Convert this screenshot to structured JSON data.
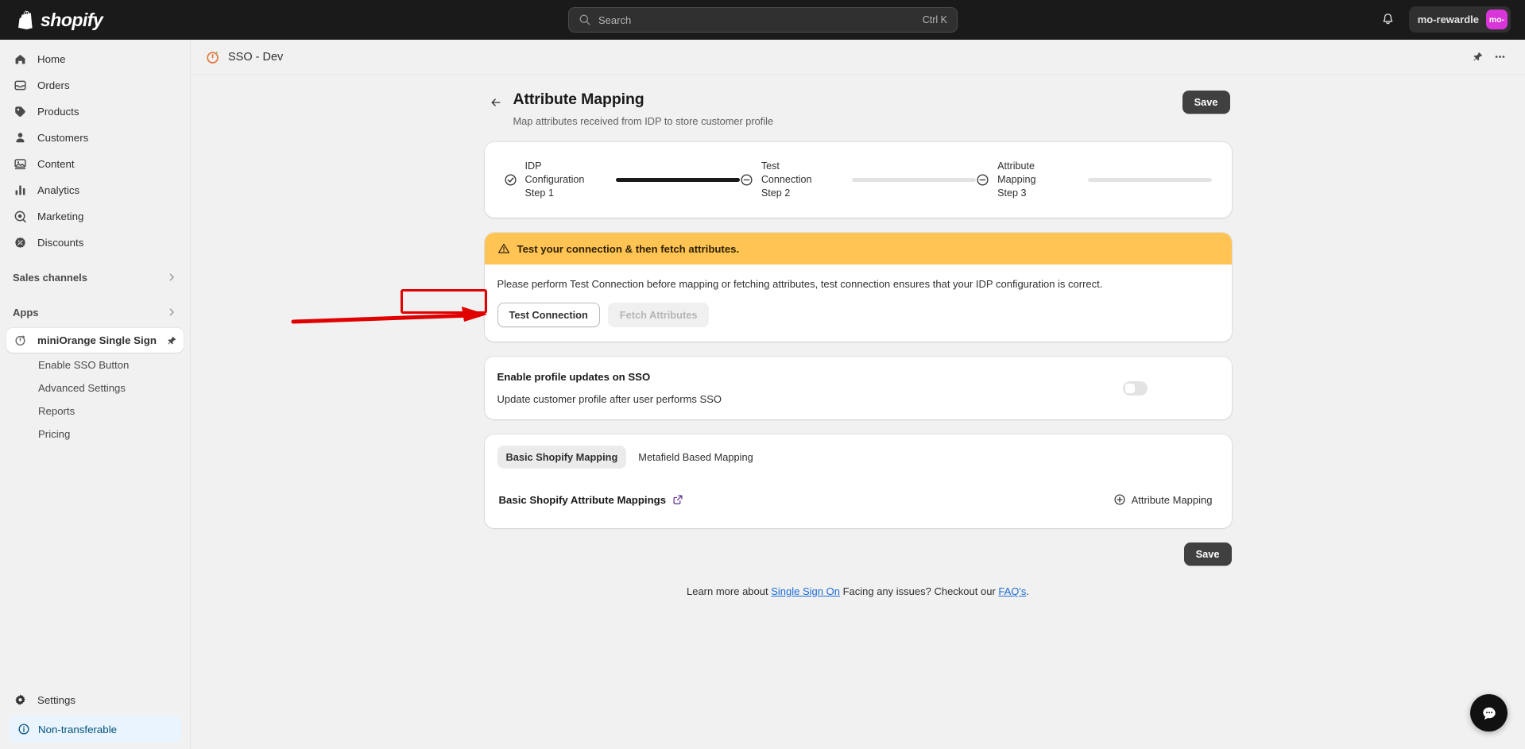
{
  "topbar": {
    "brand": "shopify",
    "search": {
      "placeholder": "Search",
      "shortcut": "Ctrl K",
      "icon": "search-icon"
    },
    "notifications_icon": "bell-icon",
    "account": {
      "name": "mo-rewardle",
      "avatar_initials": "mo-",
      "avatar_color": "#d936d9"
    }
  },
  "sidebar": {
    "items": [
      {
        "label": "Home",
        "icon": "home-icon"
      },
      {
        "label": "Orders",
        "icon": "orders-icon"
      },
      {
        "label": "Products",
        "icon": "tag-icon"
      },
      {
        "label": "Customers",
        "icon": "person-icon"
      },
      {
        "label": "Content",
        "icon": "image-icon"
      },
      {
        "label": "Analytics",
        "icon": "bar-chart-icon"
      },
      {
        "label": "Marketing",
        "icon": "target-icon"
      },
      {
        "label": "Discounts",
        "icon": "discount-icon"
      }
    ],
    "groups": [
      {
        "label": "Sales channels",
        "icon": "chevron-right-icon"
      },
      {
        "label": "Apps",
        "icon": "chevron-right-icon"
      }
    ],
    "active_app": {
      "label": "miniOrange Single Sign",
      "icon": "miniorange-icon",
      "pin_icon": "pin-icon"
    },
    "app_subitems": [
      {
        "label": "Enable SSO Button"
      },
      {
        "label": "Advanced Settings"
      },
      {
        "label": "Reports"
      },
      {
        "label": "Pricing"
      }
    ],
    "settings": {
      "label": "Settings",
      "icon": "gear-icon"
    },
    "status": {
      "label": "Non-transferable",
      "icon": "info-icon",
      "color": "#00527c",
      "background": "#eaf4ff"
    }
  },
  "app_header": {
    "title": "SSO - Dev",
    "icon": "miniorange-icon",
    "pin_icon": "pin-icon",
    "more_icon": "ellipsis-icon"
  },
  "page": {
    "back_icon": "arrow-left-icon",
    "title": "Attribute Mapping",
    "subtitle": "Map attributes received from IDP to store customer profile",
    "save_label": "Save"
  },
  "stepper": {
    "steps": [
      {
        "line1": "IDP",
        "line2": "Configuration",
        "line3": "Step 1",
        "icon": "check-circle-icon",
        "state": "complete",
        "progress": 100
      },
      {
        "line1": "Test",
        "line2": "Connection",
        "line3": "Step 2",
        "icon": "minus-circle-icon",
        "state": "pending",
        "progress": 0
      },
      {
        "line1": "Attribute",
        "line2": "Mapping",
        "line3": "Step 3",
        "icon": "minus-circle-icon",
        "state": "pending",
        "progress": 0
      }
    ]
  },
  "banner": {
    "icon": "warning-triangle-icon",
    "title": "Test your connection & then fetch attributes.",
    "background": "#ffc453",
    "description": "Please perform Test Connection before mapping or fetching attributes, test connection ensures that your IDP configuration is correct.",
    "test_connection_label": "Test Connection",
    "fetch_attributes_label": "Fetch Attributes"
  },
  "profile_updates": {
    "title": "Enable profile updates on SSO",
    "subtitle": "Update customer profile after user performs SSO",
    "toggle_state": "off"
  },
  "mapping": {
    "tabs": [
      {
        "label": "Basic Shopify Mapping",
        "active": true
      },
      {
        "label": "Metafield Based Mapping",
        "active": false
      }
    ],
    "section_title": "Basic Shopify Attribute Mappings",
    "external_link_icon": "external-link-icon",
    "external_link_color": "#5c2d91",
    "add_button_label": "Attribute Mapping",
    "add_button_icon": "plus-circle-icon"
  },
  "bottom": {
    "save_label": "Save"
  },
  "footer": {
    "text_1": "Learn more about ",
    "link_1": "Single Sign On",
    "text_2": " Facing any issues? Checkout our ",
    "link_2": "FAQ's",
    "text_3": "."
  },
  "chat": {
    "icon": "chat-bubble-icon"
  },
  "annotation": {
    "color": "#e00000",
    "target": "Test Connection"
  }
}
